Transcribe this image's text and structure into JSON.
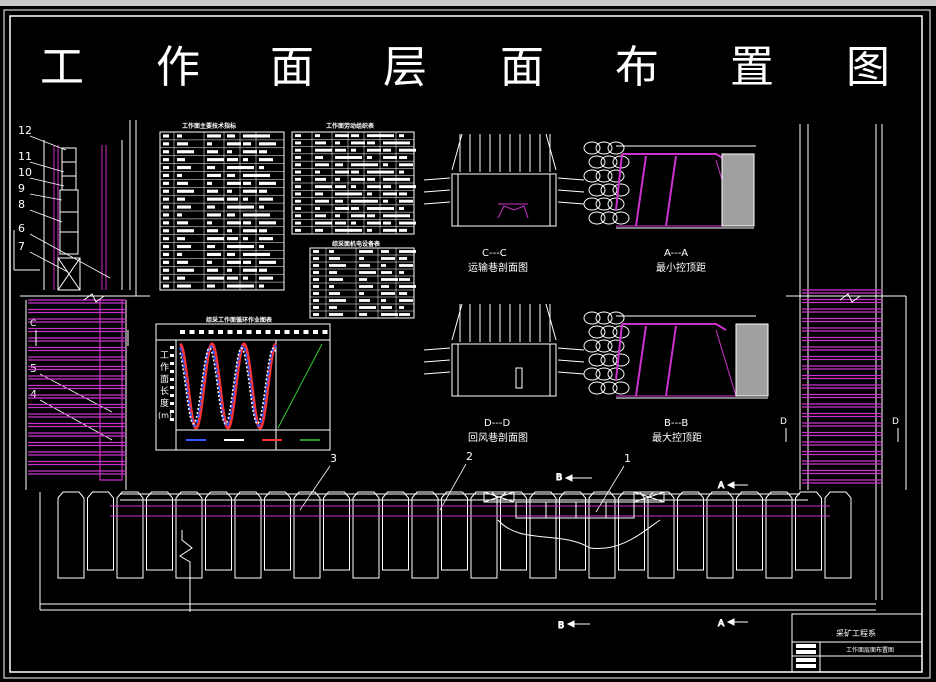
{
  "title_chars": [
    "工",
    "作",
    "面",
    "层",
    "面",
    "布",
    "置",
    "图"
  ],
  "callouts": [
    "12",
    "11",
    "10",
    "9",
    "8",
    "6",
    "7",
    "5",
    "4",
    "3",
    "2",
    "1"
  ],
  "section_letters": {
    "c": "C",
    "d": "D"
  },
  "tables": {
    "table1_title": "工作面主要技术指标",
    "table2_title": "工作面劳动组织表",
    "table3_title": "综采面机电设备表",
    "cycle_title": "综采工作面循环作业图表"
  },
  "cycle_chart": {
    "yaxis_chars": [
      "工",
      "作",
      "面",
      "长",
      "度",
      "(m)"
    ]
  },
  "sections": [
    {
      "mark": "C---C",
      "label": "运输巷剖面图"
    },
    {
      "mark": "A---A",
      "label": "最小控顶距"
    },
    {
      "mark": "D---D",
      "label": "回风巷剖面图"
    },
    {
      "mark": "B---B",
      "label": "最大控顶距"
    }
  ],
  "arrows": {
    "b_top": "B",
    "a_mid": "A",
    "b_bottom": "B",
    "a_bottom": "A"
  },
  "titleblock": {
    "dept": "采矿工程系",
    "drawing": "工作面层面布置图"
  },
  "colors": {
    "line": "#ffffff",
    "support": "#cc33cc",
    "accent_red": "#ff3333",
    "accent_blue": "#3355ff",
    "accent_green": "#33cc33",
    "gray": "#a0a0a0"
  }
}
